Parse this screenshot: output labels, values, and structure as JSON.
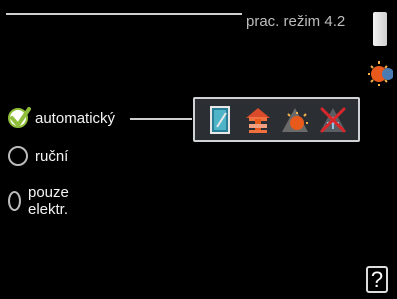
{
  "header": {
    "title": "prac. režim 4.2"
  },
  "modes": [
    {
      "label": "automatický",
      "selected": true
    },
    {
      "label": "ruční",
      "selected": false
    },
    {
      "label": "pouze elektr.",
      "selected": false
    }
  ],
  "icons": {
    "status": "sun-icon",
    "panel": [
      "hot-water-icon",
      "heating-icon",
      "heat-pump-icon",
      "cooling-off-icon"
    ],
    "help": "?"
  },
  "colors": {
    "check": "#8fbf3a",
    "accent_orange": "#e85a1c",
    "panel_bg": "#2b2f33"
  }
}
